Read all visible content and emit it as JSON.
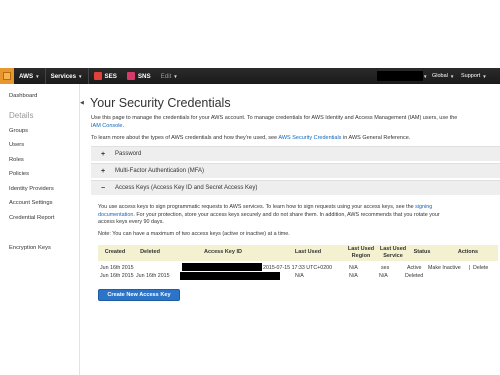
{
  "nav": {
    "aws": "AWS",
    "services": "Services",
    "ses": "SES",
    "sns": "SNS",
    "edit": "Edit",
    "global": "Global",
    "support": "Support",
    "colors": {
      "bar": "#1f1f1f",
      "ses_icon": "#e0423a",
      "sns_icon": "#d8396a",
      "logo": "#e8962e"
    }
  },
  "sidebar": {
    "dashboard": "Dashboard",
    "details_header": "Details",
    "items": [
      "Groups",
      "Users",
      "Roles",
      "Policies",
      "Identity Providers",
      "Account Settings",
      "Credential Report"
    ],
    "encryption": "Encryption Keys"
  },
  "main": {
    "title": "Your Security Credentials",
    "intro_line1": "Use this page to manage the credentials for your AWS account. To manage credentials for AWS Identity and Access Management (IAM) users, use the",
    "intro_link": "IAM Console",
    "intro_link_end": ".",
    "learn_prefix": "To learn more about the types of AWS credentials and how they're used, see",
    "learn_link": "AWS Security Credentials",
    "learn_suffix": "in AWS General Reference.",
    "accordions": [
      {
        "sign": "+",
        "label": "Password"
      },
      {
        "sign": "+",
        "label": "Multi-Factor Authentication (MFA)"
      },
      {
        "sign": "−",
        "label": "Access Keys (Access Key ID and Secret Access Key)"
      }
    ],
    "panel": {
      "p1_a": "You use access keys to sign programmatic requests to AWS services. To learn how to sign requests using your access keys, see the",
      "p1_link_a": "signing",
      "p1_link_b": "documentation",
      "p1_b": ". For your protection, store your access keys securely and do not share them. In addition, AWS recommends that you rotate your",
      "p1_c": "access keys every 90 days.",
      "note": "Note: You can have a maximum of two access keys (active or inactive) at a time."
    },
    "table": {
      "headers": {
        "created": "Created",
        "deleted": "Deleted",
        "access_key_id": "Access Key ID",
        "last_used": "Last Used",
        "last_used_region": "Last Used Region",
        "last_used_service": "Last Used Service",
        "status": "Status",
        "actions": "Actions"
      },
      "rows": [
        {
          "created": "Jun 16th 2015",
          "deleted": "",
          "last_used": "2015-07-15 17:33 UTC+0200",
          "region": "N/A",
          "service": "ses",
          "status": "Active",
          "action_a": "Make Inactive",
          "action_sep": "|",
          "action_b": "Delete"
        },
        {
          "created": "Jun 16th 2015",
          "deleted": "Jun 16th 2015",
          "last_used": "N/A",
          "region": "N/A",
          "service": "N/A",
          "status": "Deleted"
        }
      ]
    },
    "create_button": "Create New Access Key"
  }
}
